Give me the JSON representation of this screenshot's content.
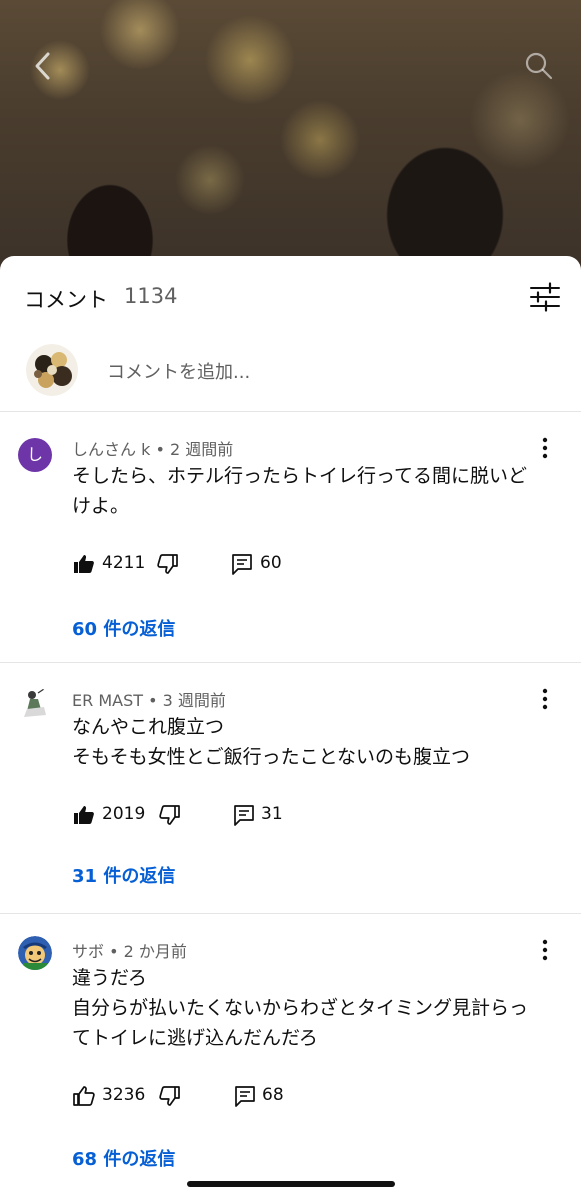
{
  "video": {
    "back_icon": "chevron-left-icon",
    "search_icon": "search-icon"
  },
  "sheet": {
    "title": "コメント",
    "count": "1134",
    "filter_icon": "tune-icon",
    "add_placeholder": "コメントを追加..."
  },
  "comments": [
    {
      "avatar_letter": "し",
      "avatar_color": "#6e35a8",
      "meta": "しんさん k • 2 週間前",
      "lines": [
        "そしたら、ホテル行ったらトイレ行ってる間に脱いど",
        "けよ。"
      ],
      "likes": "4211",
      "liked": true,
      "reply_count": "60",
      "replies_label": "60 件の返信"
    },
    {
      "avatar_letter": "",
      "meta": "ER MAST • 3 週間前",
      "lines": [
        "なんやこれ腹立つ",
        "そもそも女性とご飯行ったことないのも腹立つ"
      ],
      "likes": "2019",
      "liked": true,
      "reply_count": "31",
      "replies_label": "31 件の返信"
    },
    {
      "avatar_letter": "",
      "meta": "サボ • 2 か月前",
      "lines": [
        "違うだろ",
        "自分らが払いたくないからわざとタイミング見計らっ",
        "てトイレに逃げ込んだんだろ"
      ],
      "likes": "3236",
      "liked": false,
      "reply_count": "68",
      "replies_label": "68 件の返信"
    }
  ],
  "colors": {
    "link_blue": "#065fd4",
    "secondary_text": "#606060",
    "divider": "#e5e5e5"
  }
}
